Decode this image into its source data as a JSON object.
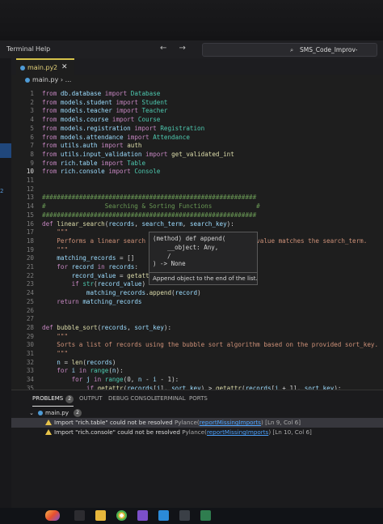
{
  "menubar": {
    "items": [
      "Terminal",
      "Help"
    ],
    "nav_arrows": "← →",
    "search_text": "SMS_Code_Improv-Python"
  },
  "sidebar": {
    "badge": "2"
  },
  "tab": {
    "label": "main.py",
    "count": "2",
    "close": "✕"
  },
  "breadcrumb": {
    "text": "main.py › ..."
  },
  "editor": {
    "lines": [
      {
        "n": "1",
        "html": "<span class='kw'>from</span> <span class='md'>db.database</span> <span class='kw'>import</span> <span class='cls'>Database</span>"
      },
      {
        "n": "2",
        "html": "<span class='kw'>from</span> <span class='md'>models.student</span> <span class='kw'>import</span> <span class='cls'>Student</span>"
      },
      {
        "n": "3",
        "html": "<span class='kw'>from</span> <span class='md'>models.teacher</span> <span class='kw'>import</span> <span class='cls'>Teacher</span>"
      },
      {
        "n": "4",
        "html": "<span class='kw'>from</span> <span class='md'>models.course</span> <span class='kw'>import</span> <span class='cls'>Course</span>"
      },
      {
        "n": "5",
        "html": "<span class='kw'>from</span> <span class='md'>models.registration</span> <span class='kw'>import</span> <span class='cls'>Registration</span>"
      },
      {
        "n": "6",
        "html": "<span class='kw'>from</span> <span class='md'>models.attendance</span> <span class='kw'>import</span> <span class='cls'>Attendance</span>"
      },
      {
        "n": "7",
        "html": "<span class='kw'>from</span> <span class='md'>utils.auth</span> <span class='kw'>import</span> <span class='fn'>auth</span>"
      },
      {
        "n": "8",
        "html": "<span class='kw'>from</span> <span class='md'>utils.input_validation</span> <span class='kw'>import</span> <span class='fn'>get_validated_int</span>"
      },
      {
        "n": "9",
        "html": "<span class='kw'>from</span> <span class='md'>rich.table</span> <span class='kw'>import</span> <span class='cls'>Table</span>"
      },
      {
        "n": "10",
        "html": "<span class='kw'>from</span> <span class='md'>rich.console</span> <span class='kw'>import</span> <span class='cls'>Console</span>"
      },
      {
        "n": "11",
        "html": ""
      },
      {
        "n": "12",
        "html": ""
      },
      {
        "n": "13",
        "html": "<span class='cm'>##########################################################</span>"
      },
      {
        "n": "14",
        "html": "<span class='cm'>#                Searching &amp; Sorting Functions            #</span>"
      },
      {
        "n": "15",
        "html": "<span class='cm'>##########################################################</span>"
      },
      {
        "n": "16",
        "html": "<span class='kw'>def</span> <span class='fn'>linear_search</span>(<span class='md'>records</span>, <span class='md'>search_term</span>, <span class='md'>search_key</span>):"
      },
      {
        "n": "17",
        "html": "    <span class='st'>\"\"\"</span>"
      },
      {
        "n": "18",
        "html": "    <span class='st'>Performs a linear search                           ′s value matches the search_term.</span>"
      },
      {
        "n": "19",
        "html": "    <span class='st'>\"\"\"</span>"
      },
      {
        "n": "20",
        "html": "    <span class='md'>matching_records</span> = []"
      },
      {
        "n": "21",
        "html": "    <span class='kw'>for</span> <span class='md'>record</span> <span class='kw'>in</span> <span class='md'>records</span>:"
      },
      {
        "n": "22",
        "html": "        <span class='md'>record_value</span> = <span class='bi'>getatt</span>"
      },
      {
        "n": "23",
        "html": "        <span class='kw'>if</span> <span class='cls'>str</span>(<span class='md'>record_value</span>)"
      },
      {
        "n": "24",
        "html": "            <span class='md'>matching_records</span>.<span class='fn'>append</span>(<span class='md'>record</span>)"
      },
      {
        "n": "25",
        "html": "    <span class='kw'>return</span> <span class='md'>matching_records</span>"
      },
      {
        "n": "26",
        "html": ""
      },
      {
        "n": "27",
        "html": ""
      },
      {
        "n": "28",
        "html": "<span class='kw'>def</span> <span class='fn'>bubble_sort</span>(<span class='md'>records</span>, <span class='md'>sort_key</span>):"
      },
      {
        "n": "29",
        "html": "    <span class='st'>\"\"\"</span>"
      },
      {
        "n": "30",
        "html": "    <span class='st'>Sorts a list of records using the bubble sort algorithm based on the provided sort_key.</span>"
      },
      {
        "n": "31",
        "html": "    <span class='st'>\"\"\"</span>"
      },
      {
        "n": "32",
        "html": "    <span class='md'>n</span> = <span class='fn'>len</span>(<span class='md'>records</span>)"
      },
      {
        "n": "33",
        "html": "    <span class='kw'>for</span> <span class='md'>i</span> <span class='kw'>in</span> <span class='cls'>range</span>(<span class='md'>n</span>):"
      },
      {
        "n": "34",
        "html": "        <span class='kw'>for</span> <span class='md'>j</span> <span class='kw'>in</span> <span class='cls'>range</span>(0, <span class='md'>n</span> - <span class='md'>i</span> - 1):"
      },
      {
        "n": "35",
        "html": "            <span class='kw'>if</span> <span class='fn'>getattr</span>(<span class='md'>records</span>[<span class='md'>j</span>], <span class='md'>sort_key</span>) &gt; <span class='fn'>getattr</span>(<span class='md'>records</span>[<span class='md'>j</span> + 1], <span class='md'>sort_key</span>):"
      }
    ]
  },
  "hover": {
    "sig_line1": "(method) def append(",
    "sig_line2": "    __object: Any,",
    "sig_line3": "    /",
    "sig_line4": ") -> None",
    "doc": "Append object to the end of the list."
  },
  "panel": {
    "tabs": [
      "PROBLEMS",
      "OUTPUT",
      "DEBUG CONSOLE",
      "TERMINAL",
      "PORTS"
    ],
    "problems_count": "2",
    "file": "main.py",
    "file_count": "2",
    "problems": [
      {
        "msg": "Import \"rich.table\" could not be resolved",
        "src": "Pylance(",
        "code": "reportMissingImports",
        "close": ")",
        "loc": "[Ln 9, Col 6]"
      },
      {
        "msg": "Import \"rich.console\" could not be resolved",
        "src": "Pylance(",
        "code": "reportMissingImports",
        "close": ")",
        "loc": "[Ln 10, Col 6]"
      }
    ]
  }
}
